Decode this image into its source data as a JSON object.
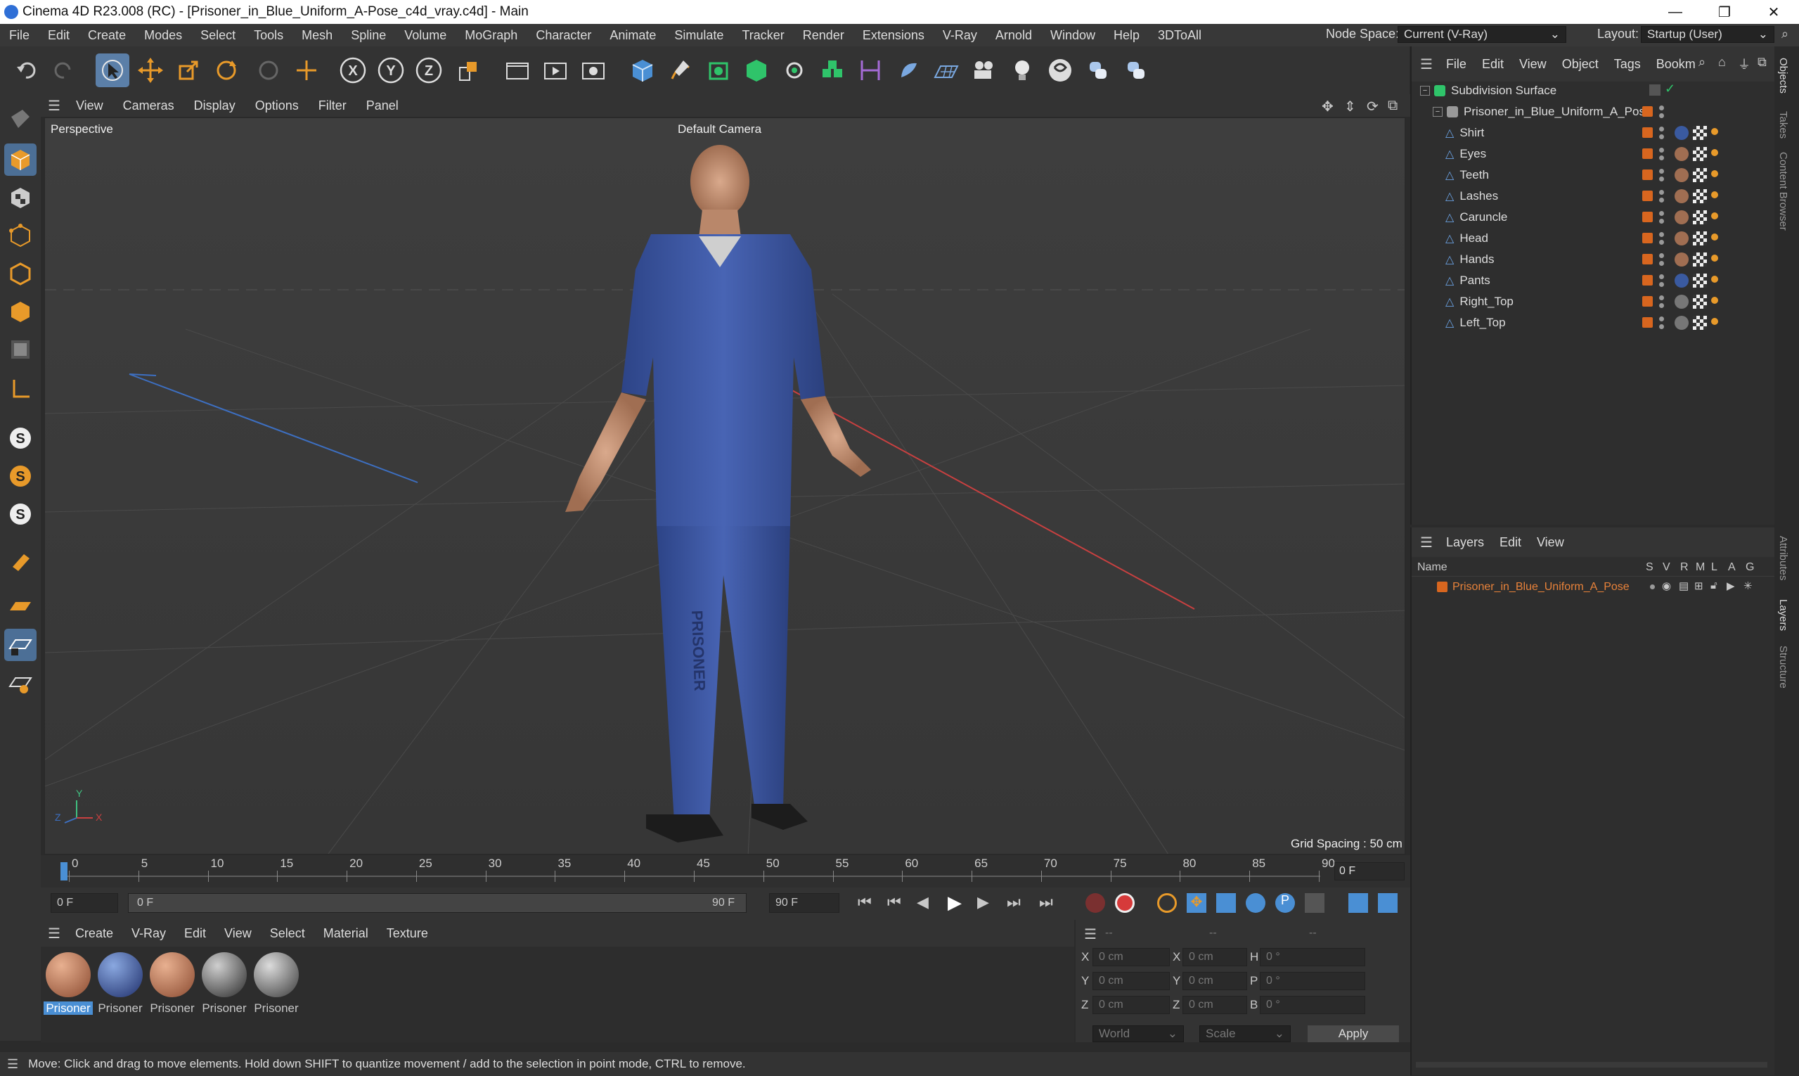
{
  "titlebar": {
    "title": "Cinema 4D R23.008 (RC) - [Prisoner_in_Blue_Uniform_A-Pose_c4d_vray.c4d] - Main",
    "minimize": "—",
    "maximize": "❐",
    "close": "✕"
  },
  "menubar": {
    "items": [
      "File",
      "Edit",
      "Create",
      "Modes",
      "Select",
      "Tools",
      "Mesh",
      "Spline",
      "Volume",
      "MoGraph",
      "Character",
      "Animate",
      "Simulate",
      "Tracker",
      "Render",
      "Extensions",
      "V-Ray",
      "Arnold",
      "Window",
      "Help",
      "3DToAll"
    ],
    "node_space_label": "Node Space:",
    "node_space_value": "Current (V-Ray)",
    "layout_label": "Layout:",
    "layout_value": "Startup (User)"
  },
  "viewport": {
    "menu": [
      "View",
      "Cameras",
      "Display",
      "Options",
      "Filter",
      "Panel"
    ],
    "label": "Perspective",
    "camera": "Default Camera",
    "grid_spacing": "Grid Spacing : 50 cm",
    "axis_x": "X",
    "axis_y": "Y",
    "axis_z": "Z",
    "pants_text": "PRISONER"
  },
  "timeline": {
    "ticks": [
      "0",
      "5",
      "10",
      "15",
      "20",
      "25",
      "30",
      "35",
      "40",
      "45",
      "50",
      "55",
      "60",
      "65",
      "70",
      "75",
      "80",
      "85",
      "90"
    ],
    "current_frame": "0 F",
    "start": "0 F",
    "range_start": "0 F",
    "range_end": "90 F",
    "end": "90 F"
  },
  "materials": {
    "menu": [
      "Create",
      "V-Ray",
      "Edit",
      "View",
      "Select",
      "Material",
      "Texture"
    ],
    "items": [
      "Prisoner",
      "Prisoner",
      "Prisoner",
      "Prisoner",
      "Prisoner"
    ],
    "colors": [
      "#b06a48",
      "#3a5aa0",
      "#b06a48",
      "#5a5a5a",
      "#6a6a6a"
    ]
  },
  "coords": {
    "header": [
      "--",
      "--",
      "--"
    ],
    "rows": [
      {
        "a": "X",
        "av": "0 cm",
        "b": "X",
        "bv": "0 cm",
        "c": "H",
        "cv": "0 °"
      },
      {
        "a": "Y",
        "av": "0 cm",
        "b": "Y",
        "bv": "0 cm",
        "c": "P",
        "cv": "0 °"
      },
      {
        "a": "Z",
        "av": "0 cm",
        "b": "Z",
        "bv": "0 cm",
        "c": "B",
        "cv": "0 °"
      }
    ],
    "world": "World",
    "scale": "Scale",
    "apply": "Apply"
  },
  "status": "Move: Click and drag to move elements. Hold down SHIFT to quantize movement / add to the selection in point mode, CTRL to remove.",
  "objects": {
    "menu": [
      "File",
      "Edit",
      "View",
      "Object",
      "Tags",
      "Bookm"
    ],
    "root": "Subdivision Surface",
    "group": "Prisoner_in_Blue_Uniform_A_Pose",
    "children": [
      "Shirt",
      "Eyes",
      "Teeth",
      "Lashes",
      "Caruncle",
      "Head",
      "Hands",
      "Pants",
      "Right_Top",
      "Left_Top"
    ]
  },
  "layers": {
    "menu": [
      "Layers",
      "Edit",
      "View"
    ],
    "cols": [
      "Name",
      "S",
      "V",
      "R",
      "M",
      "L",
      "A",
      "G"
    ],
    "items": [
      "Prisoner_in_Blue_Uniform_A_Pose"
    ]
  },
  "sidetabs": [
    "Objects",
    "Takes",
    "Content Browser",
    "Attributes",
    "Layers",
    "Structure"
  ]
}
